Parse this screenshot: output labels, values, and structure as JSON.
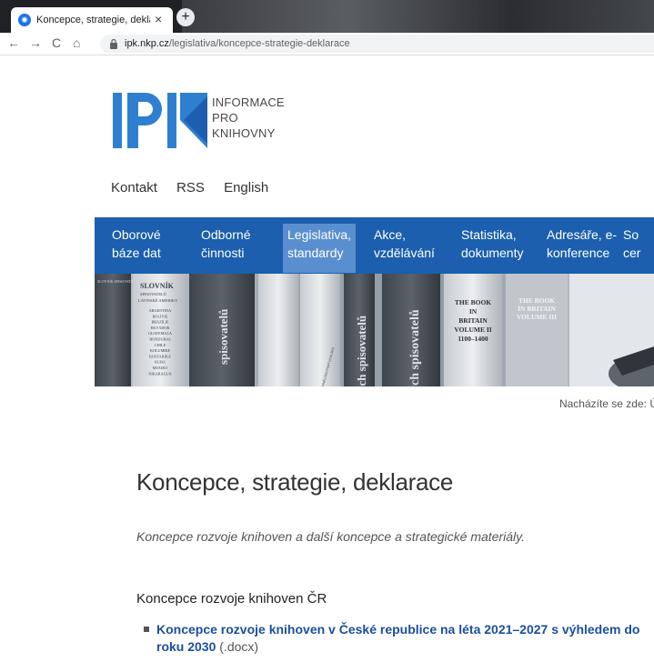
{
  "browser": {
    "tab_title": "Koncepce, strategie, deklarace – ",
    "tab_close": "×",
    "new_tab": "+",
    "url_domain": "ipk.nkp.cz",
    "url_path": "/legislativa/koncepce-strategie-deklarace",
    "nav_back": "←",
    "nav_forward": "→",
    "nav_reload": "C",
    "nav_home": "⌂"
  },
  "logo": {
    "letters": "IPK",
    "line1": "INFORMACE",
    "line2": "PRO",
    "line3": "KNIHOVNY",
    "accent_color": "#2f7fd1"
  },
  "top_links": [
    "Kontakt",
    "RSS",
    "English"
  ],
  "main_nav": {
    "items": [
      {
        "line1": "Oborové",
        "line2": "báze dat"
      },
      {
        "line1": "Odborné",
        "line2": "činnosti"
      },
      {
        "line1": "Legislativa,",
        "line2": "standardy"
      },
      {
        "line1": "Akce,",
        "line2": "vzdělávání"
      },
      {
        "line1": "Statistika,",
        "line2": "dokumenty"
      },
      {
        "line1": "Adresáře, e-",
        "line2": "konference"
      },
      {
        "line1": "So",
        "line2": "cer"
      }
    ],
    "active_index": 2,
    "color": "#1b5fae"
  },
  "banner": {
    "book1_title": "SLOVNÍK",
    "book1_sub": "SPISOVATELŮ",
    "book1_sub2": "LATINSKÉ AMERIKY",
    "book1_countries": [
      "ARGENTINA",
      "BOLÍVIE",
      "BRAZÍLIE",
      "EKVÁDOR",
      "GUATEMALA",
      "HONDURAS",
      "CHILE",
      "KOLUMBIE",
      "KOSTARIKA",
      "KUBA",
      "MEXIKO",
      "NIKARAGUA"
    ],
    "spine1": "spisovatelů",
    "spine2": "ých spisovatelů",
    "spine3": "ých spisovatelů",
    "book_britain1": [
      "THE BOOK",
      "IN",
      "BRITAIN",
      "VOLUME II",
      "1100–1400"
    ],
    "book_britain2": [
      "THE BOOK",
      "IN BRITAIN",
      "VOLUME III"
    ],
    "small_left": "SLOVNÍK SPISOVATELŮ",
    "small_spine": "ŠPANĚLSKO PORTUGALSKO"
  },
  "breadcrumb": "Nacházíte se zde: Ú",
  "page": {
    "title": "Koncepce, strategie, deklarace",
    "lead": "Koncepce rozvoje knihoven a další koncepce a strategické materiály.",
    "section_heading": "Koncepce rozvoje knihoven ČR",
    "documents": [
      {
        "link": "Koncepce rozvoje knihoven v České republice na léta 2021–2027 s výhledem do roku 2030",
        "ext": " (.docx)"
      }
    ]
  }
}
